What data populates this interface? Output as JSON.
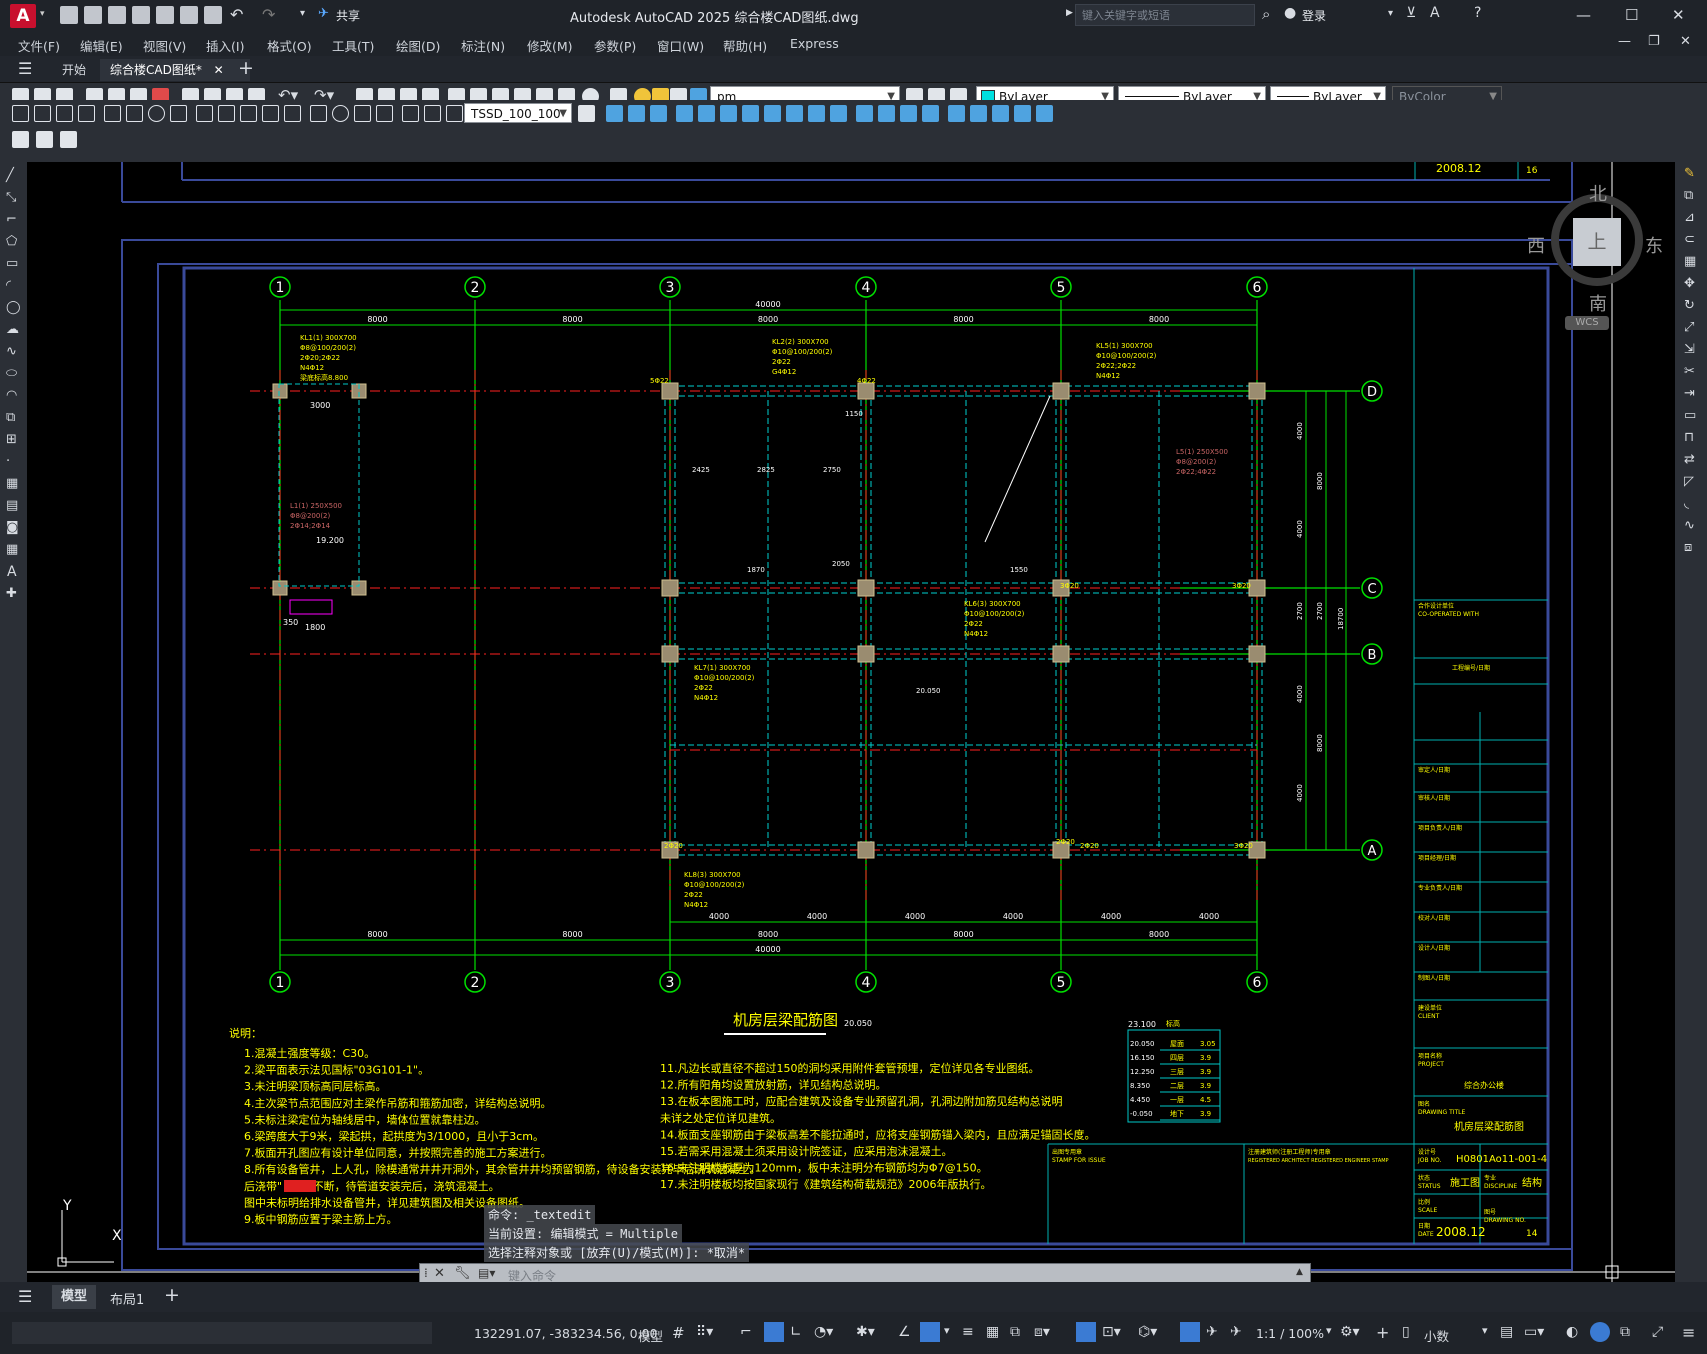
{
  "app": {
    "logo": "A",
    "share_label": "共享",
    "title": "Autodesk AutoCAD 2025    综合楼CAD图纸.dwg",
    "search_placeholder": "键入关键字或短语",
    "login_label": "登录"
  },
  "menu": [
    "文件(F)",
    "编辑(E)",
    "视图(V)",
    "插入(I)",
    "格式(O)",
    "工具(T)",
    "绘图(D)",
    "标注(N)",
    "修改(M)",
    "参数(P)",
    "窗口(W)",
    "帮助(H)",
    "Express"
  ],
  "tabs": {
    "start": "开始",
    "drawing": "综合楼CAD图纸*",
    "add": "+"
  },
  "toolbar": {
    "layer_value": "pm",
    "color_value": "ByLayer",
    "linetype_value": "ByLayer",
    "lineweight_value": "ByLayer",
    "plotstyle_value": "ByColor",
    "dimstyle_value": "TSSD_100_100"
  },
  "viewcube": {
    "north": "北",
    "south": "南",
    "east": "东",
    "west": "西",
    "top": "上",
    "wcs": "WCS"
  },
  "drawing": {
    "top_date": "2008.12",
    "top_sheet": "16",
    "axes_x": [
      "1",
      "2",
      "3",
      "4",
      "5",
      "6"
    ],
    "axes_y": [
      "D",
      "C",
      "B",
      "A"
    ],
    "span_labels": [
      "8000",
      "8000",
      "8000",
      "8000",
      "8000"
    ],
    "overall": "40000",
    "sub_spans": [
      "4000",
      "4000",
      "4000",
      "4000",
      "4000",
      "4000"
    ],
    "right_dims": [
      "4000",
      "4000",
      "2700",
      "4000",
      "4000"
    ],
    "right_totals": [
      "8000",
      "2700",
      "8000"
    ],
    "right_overall": "18700",
    "plan_title": "机房层梁配筋图",
    "plan_elev": "20.050",
    "beam_KL1": [
      "KL1(1) 300X700",
      "Φ8@100/200(2)",
      "2Φ20;2Φ22",
      "N4Φ12",
      "梁底标高8.800"
    ],
    "beam_KL2": [
      "KL2(2) 300X700",
      "Φ10@100/200(2)",
      "2Φ22",
      "G4Φ12"
    ],
    "beam_KL5": [
      "KL5(1) 300X700",
      "Φ10@100/200(2)",
      "2Φ22;2Φ22",
      "N4Φ12"
    ],
    "beam_KL8": [
      "KL8(3) 300X700",
      "Φ10@100/200(2)",
      "2Φ22",
      "N4Φ12"
    ],
    "beam_KL7": [
      "KL7(1) 300X700",
      "Φ10@100/200(2)",
      "2Φ22",
      "N4Φ12"
    ],
    "beam_KL6": [
      "KL6(3) 300X700",
      "Φ10@100/200(2)",
      "2Φ22",
      "N4Φ12"
    ],
    "beam_L5": [
      "L5(1) 250X500",
      "Φ8@200(2)",
      "2Φ22;4Φ22"
    ],
    "beam_L1": [
      "L1(1) 250X500",
      "Φ8@200(2)",
      "2Φ14;2Φ14"
    ],
    "elev_19200": "19.200",
    "elev_20050": "20.050",
    "misc": [
      "2825",
      "2425",
      "2750",
      "2050",
      "1150",
      "1550",
      "1870",
      "3000",
      "1800",
      "5Φ22",
      "4Φ22",
      "3Φ20",
      "2Φ20"
    ],
    "notes_title": "说明：",
    "notes_left": [
      "1.混凝土强度等级：C30。",
      "2.梁平面表示法见国标\"03G101-1\"。",
      "3.未注明梁顶标高同层标高。",
      "4.主次梁节点范围应对主梁作吊筋和箍筋加密，详结构总说明。",
      "5.未标注梁定位为轴线居中，墙体位置就靠柱边。",
      "6.梁跨度大于9米，梁起拱，起拱度为3/1000，且小于3cm。",
      "7.板面开孔图应有设计单位同意，并按照完善的施工方案进行。",
      "8.所有设备管井，上人孔，除模通常井井开洞外，其余管井井均预留钢筋，待设备安装完毕后浇筑混凝土。",
      "   后浇带\"       \"钢筋不断，待管道安装完后，浇筑混凝土。",
      "   图中未标明给排水设备管井，详见建筑图及相关设备图纸。",
      "9.板中钢筋应置于梁主筋上方。"
    ],
    "notes_right": [
      "11.凡边长或直径不超过150的洞均采用附件套管预埋，定位详见各专业图纸。",
      "12.所有阳角均设置放射筋，详见结构总说明。",
      "13.在板本图施工时，应配合建筑及设备专业预留孔洞，孔洞边附加筋见结构总说明",
      "    未详之处定位详见建筑。",
      "14.板面支座钢筋由于梁板高差不能拉通时，应将支座钢筋锚入梁内，且应满足锚固长度。",
      "15.若需采用混凝土须采用设计院签证，应采用泡沫混凝土。",
      "16.未注明楼板厚为120mm，板中未注明分布钢筋均为Φ7@150。",
      "17.未注明楼板均按国家现行《建筑结构荷载规范》2006年版执行。"
    ],
    "level_table_header": [
      "标高",
      "层高"
    ],
    "level_table": [
      [
        "20.050",
        "屋面",
        "3.05"
      ],
      [
        "16.150",
        "四层",
        "3.9"
      ],
      [
        "12.250",
        "三层",
        "3.9"
      ],
      [
        "8.350",
        "二层",
        "3.9"
      ],
      [
        "4.450",
        "一层",
        "4.5"
      ],
      [
        "-0.050",
        "地下",
        "3.9"
      ]
    ],
    "level_top": "23.100",
    "titleblock": {
      "cooperated": "合作设计单位",
      "cooperated_en": "CO-OPERATED WITH",
      "eng_no": "工程编号/日期",
      "authorized": "审定人/日期",
      "reviewed": "审核人/日期",
      "project_director": "项目负责人/日期",
      "project_manager": "项目经理/日期",
      "discipline": "专业负责人/日期",
      "checked": "校对人/日期",
      "designed": "设计人/日期",
      "drawn": "制图人/日期",
      "client": "建设单位",
      "client_en": "CLIENT",
      "project": "项目名称",
      "project_en": "PROJECT",
      "project_value": "综合办公楼",
      "drawing_title": "图名",
      "drawing_title_en": "DRAWING TITLE",
      "drawing_title_value": "机房层梁配筋图",
      "stamp": "出图专用章",
      "stamp_en": "STAMP FOR ISSUE",
      "reg_stamp": "注册建筑师(注册工程师)专用章",
      "reg_stamp_en": "REGISTERED ARCHITECT REGISTERED ENGINEER STAMP",
      "job_no_label": "设计号",
      "job_no_en": "JOB NO.",
      "job_no": "H0801Ao11-001-4",
      "status_label": "状态",
      "status_en": "STATUS",
      "status": "施工图",
      "discipline_label": "专业",
      "discipline_en": "DISCIPLINE",
      "discipline_value": "结构",
      "scale_label": "比例",
      "scale_en": "SCALE",
      "drawing_no_label": "图号",
      "drawing_no_en": "DRAWING NO.",
      "drawing_no": "14",
      "date_label": "日期",
      "date_en": "DATE",
      "date": "2008.12"
    }
  },
  "command": {
    "line1": "命令: _textedit",
    "line2": "当前设置: 编辑模式 = Multiple",
    "line3": "选择注释对象或 [放弃(U)/模式(M)]: *取消*",
    "input_placeholder": "键入命令"
  },
  "ucs": {
    "y": "Y",
    "x": "X"
  },
  "layout_tabs": {
    "model": "模型",
    "layout1": "布局1",
    "add": "+"
  },
  "status": {
    "coords": "132291.07, -383234.56, 0.00",
    "model": "模型",
    "scale": "1:1 / 100%",
    "units": "小数"
  },
  "colors": {
    "background": "#000000",
    "grid_green": "#00ff00",
    "axis_red": "#ff0000",
    "cyan": "#00ffff",
    "yellow": "#ffff00",
    "frame_blue": "#3a4a9a"
  }
}
